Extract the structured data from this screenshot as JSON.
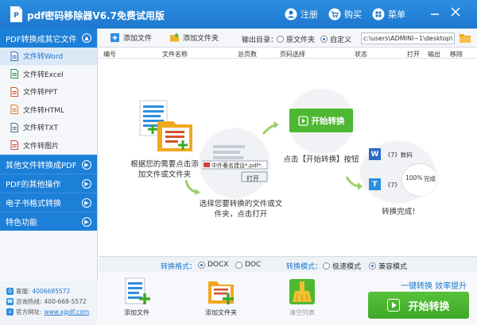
{
  "app": {
    "title": "pdf密码移除器V6.7免费试用版",
    "buttons": {
      "register": "注册",
      "buy": "购买",
      "menu": "菜单"
    }
  },
  "sidebar": {
    "section1": {
      "label": "PDF转换成其它文件",
      "items": [
        {
          "label": "文件转Word",
          "icon": "word-file-icon",
          "color": "#2b6cc4"
        },
        {
          "label": "文件转Excel",
          "icon": "excel-file-icon",
          "color": "#1f8f3a"
        },
        {
          "label": "文件转PPT",
          "icon": "ppt-file-icon",
          "color": "#d2532a"
        },
        {
          "label": "文件转HTML",
          "icon": "html-file-icon",
          "color": "#e07b1d"
        },
        {
          "label": "文件转TXT",
          "icon": "txt-file-icon",
          "color": "#4a6a8a"
        },
        {
          "label": "文件转图片",
          "icon": "image-file-icon",
          "color": "#c9443c"
        }
      ]
    },
    "sections": [
      {
        "label": "其他文件转换成PDF"
      },
      {
        "label": "PDF的其他操作"
      },
      {
        "label": "电子书格式转换"
      },
      {
        "label": "特色功能"
      }
    ],
    "footer": {
      "qq_label": "客服:",
      "qq_value": "4006685572",
      "hotline_label": "咨询热线:",
      "hotline_value": "400-668-5572",
      "site_label": "官方网址:",
      "site_value": "www.xjpdf.com"
    }
  },
  "toolbar": {
    "add_file": "添加文件",
    "add_folder": "添加文件夹",
    "output_label": "输出目录：",
    "radio_original": "原文件夹",
    "radio_custom": "自定义",
    "path_value": "c:\\users\\ADMINI~1\\desktop\\"
  },
  "table_headers": {
    "index": "编号",
    "name": "文件名称",
    "pages": "总页数",
    "page_select": "页码选择",
    "status": "状态",
    "open": "打开",
    "output": "输出",
    "remove": "移除"
  },
  "guide": {
    "step1": "根据您的需要点击添加文件或文件夹",
    "step2": "选择您要转换的文件或文件夹，点击打开",
    "step3": "点击【开始转换】按钮",
    "step4": "转换完成！",
    "dialog_title": "中外著名建设*.pdf*.",
    "dialog_open": "打开",
    "start_label": "开始转换",
    "result1": "《7》数码",
    "result2": "《7》",
    "percent": "100%",
    "done": "完成"
  },
  "options": {
    "format_label": "转换格式：",
    "format_docx": "DOCX",
    "format_doc": "DOC",
    "mode_label": "转换模式：",
    "mode_fast": "极速模式",
    "mode_compat": "兼容模式"
  },
  "bottom": {
    "add_file": "添加文件",
    "add_folder": "添加文件夹",
    "clear_list": "清空列表",
    "slogan": "一键转换  效率提升",
    "start": "开始转换"
  }
}
